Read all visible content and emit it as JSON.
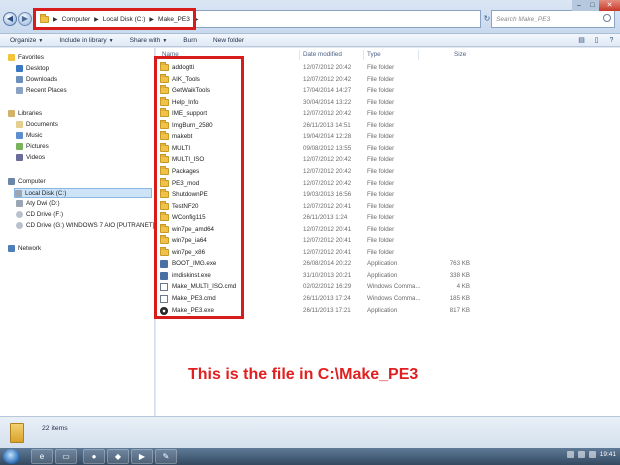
{
  "address": {
    "segments": [
      "Computer",
      "Local Disk (C:)",
      "Make_PE3"
    ]
  },
  "search": {
    "placeholder": "Search Make_PE3"
  },
  "toolbar": {
    "organize": "Organize",
    "include": "Include in library",
    "share": "Share with",
    "burn": "Burn",
    "new_folder": "New folder"
  },
  "nav": {
    "favorites": "Favorites",
    "desktop": "Desktop",
    "downloads": "Downloads",
    "recent": "Recent Places",
    "libraries": "Libraries",
    "documents": "Documents",
    "music": "Music",
    "pictures": "Pictures",
    "videos": "Videos",
    "computer": "Computer",
    "local_disk": "Local Disk (C:)",
    "aty_dwi": "Aty Dwi (D:)",
    "cd_f": "CD Drive (F:)",
    "cd_g": "CD Drive (G:) WINDOWS 7 AIO [PUTRANET]",
    "network": "Network"
  },
  "columns": {
    "name": "Name",
    "date": "Date modified",
    "type": "Type",
    "size": "Size"
  },
  "files": [
    {
      "name": "addogtti",
      "date": "12/07/2012 20:42",
      "type": "File folder",
      "size": "",
      "icon": "folder-icon"
    },
    {
      "name": "AIK_Tools",
      "date": "12/07/2012 20:42",
      "type": "File folder",
      "size": "",
      "icon": "folder-icon"
    },
    {
      "name": "GetWaikTools",
      "date": "17/04/2014 14:27",
      "type": "File folder",
      "size": "",
      "icon": "folder-icon"
    },
    {
      "name": "Help_Info",
      "date": "30/04/2014 13:22",
      "type": "File folder",
      "size": "",
      "icon": "folder-icon"
    },
    {
      "name": "IME_support",
      "date": "12/07/2012 20:42",
      "type": "File folder",
      "size": "",
      "icon": "folder-icon"
    },
    {
      "name": "ImgBurn_2580",
      "date": "26/11/2013 14:51",
      "type": "File folder",
      "size": "",
      "icon": "folder-icon"
    },
    {
      "name": "makebt",
      "date": "19/04/2014 12:28",
      "type": "File folder",
      "size": "",
      "icon": "folder-icon"
    },
    {
      "name": "MULTI",
      "date": "09/08/2012 13:55",
      "type": "File folder",
      "size": "",
      "icon": "folder-icon"
    },
    {
      "name": "MULTI_ISO",
      "date": "12/07/2012 20:42",
      "type": "File folder",
      "size": "",
      "icon": "folder-icon"
    },
    {
      "name": "Packages",
      "date": "12/07/2012 20:42",
      "type": "File folder",
      "size": "",
      "icon": "folder-icon"
    },
    {
      "name": "PE3_mod",
      "date": "12/07/2012 20:42",
      "type": "File folder",
      "size": "",
      "icon": "folder-icon"
    },
    {
      "name": "ShutdownPE",
      "date": "19/03/2013 16:56",
      "type": "File folder",
      "size": "",
      "icon": "folder-icon"
    },
    {
      "name": "TestNF20",
      "date": "12/07/2012 20:41",
      "type": "File folder",
      "size": "",
      "icon": "folder-icon"
    },
    {
      "name": "WConfig115",
      "date": "26/11/2013 1:24",
      "type": "File folder",
      "size": "",
      "icon": "folder-icon"
    },
    {
      "name": "win7pe_amd64",
      "date": "12/07/2012 20:41",
      "type": "File folder",
      "size": "",
      "icon": "folder-icon"
    },
    {
      "name": "win7pe_ia64",
      "date": "12/07/2012 20:41",
      "type": "File folder",
      "size": "",
      "icon": "folder-icon"
    },
    {
      "name": "win7pe_x86",
      "date": "12/07/2012 20:41",
      "type": "File folder",
      "size": "",
      "icon": "folder-icon"
    },
    {
      "name": "BOOT_IMG.exe",
      "date": "26/08/2014 20:22",
      "type": "Application",
      "size": "763 KB",
      "icon": "exe-icon"
    },
    {
      "name": "imdiskinst.exe",
      "date": "31/10/2013 20:21",
      "type": "Application",
      "size": "338 KB",
      "icon": "exe-icon"
    },
    {
      "name": "Make_MULTI_ISO.cmd",
      "date": "02/02/2012 16:29",
      "type": "Windows Comma...",
      "size": "4 KB",
      "icon": "cmd-icon"
    },
    {
      "name": "Make_PE3.cmd",
      "date": "26/11/2013 17:24",
      "type": "Windows Comma...",
      "size": "185 KB",
      "icon": "cmd-icon"
    },
    {
      "name": "Make_PE3.exe",
      "date": "26/11/2013 17:21",
      "type": "Application",
      "size": "817 KB",
      "icon": "disc-exe-icon"
    }
  ],
  "caption": "This is the file in C:\\Make_PE3",
  "status": {
    "count": "22 items"
  },
  "clock": "19:41",
  "colors": {
    "highlight": "#d81b1b",
    "caption": "#e02020"
  }
}
